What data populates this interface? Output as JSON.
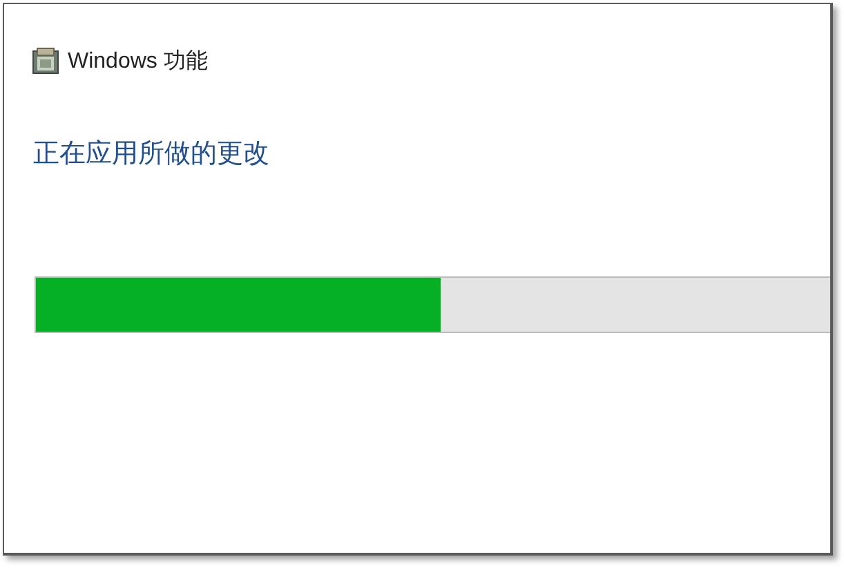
{
  "window": {
    "title": "Windows 功能"
  },
  "heading": "正在应用所做的更改",
  "progress": {
    "level": 0.51
  }
}
